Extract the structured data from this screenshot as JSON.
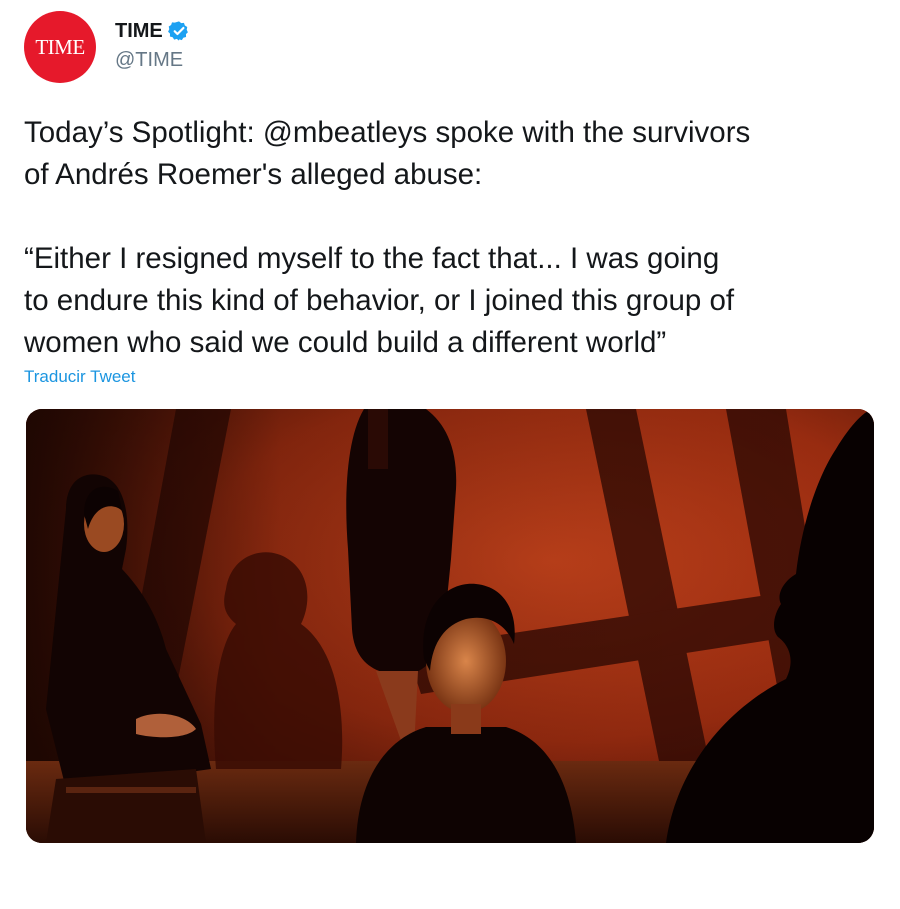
{
  "author": {
    "avatar_text": "TIME",
    "avatar_color": "#e6192b",
    "display_name": "TIME",
    "handle": "@TIME",
    "verified": true,
    "verified_color": "#1da1f2"
  },
  "tweet": {
    "text": "Today’s Spotlight: @mbeatleys spoke with the survivors\nof Andrés Roemer's alleged abuse:\n\n“Either I resigned myself to the fact that... I was going\nto endure this kind of behavior, or I joined this group of\nwomen who said we could build a different world”",
    "translate_label": "Traducir Tweet",
    "link_color": "#1b95e0"
  },
  "media": {
    "icon": "photo",
    "background_color": "#b8391a"
  }
}
